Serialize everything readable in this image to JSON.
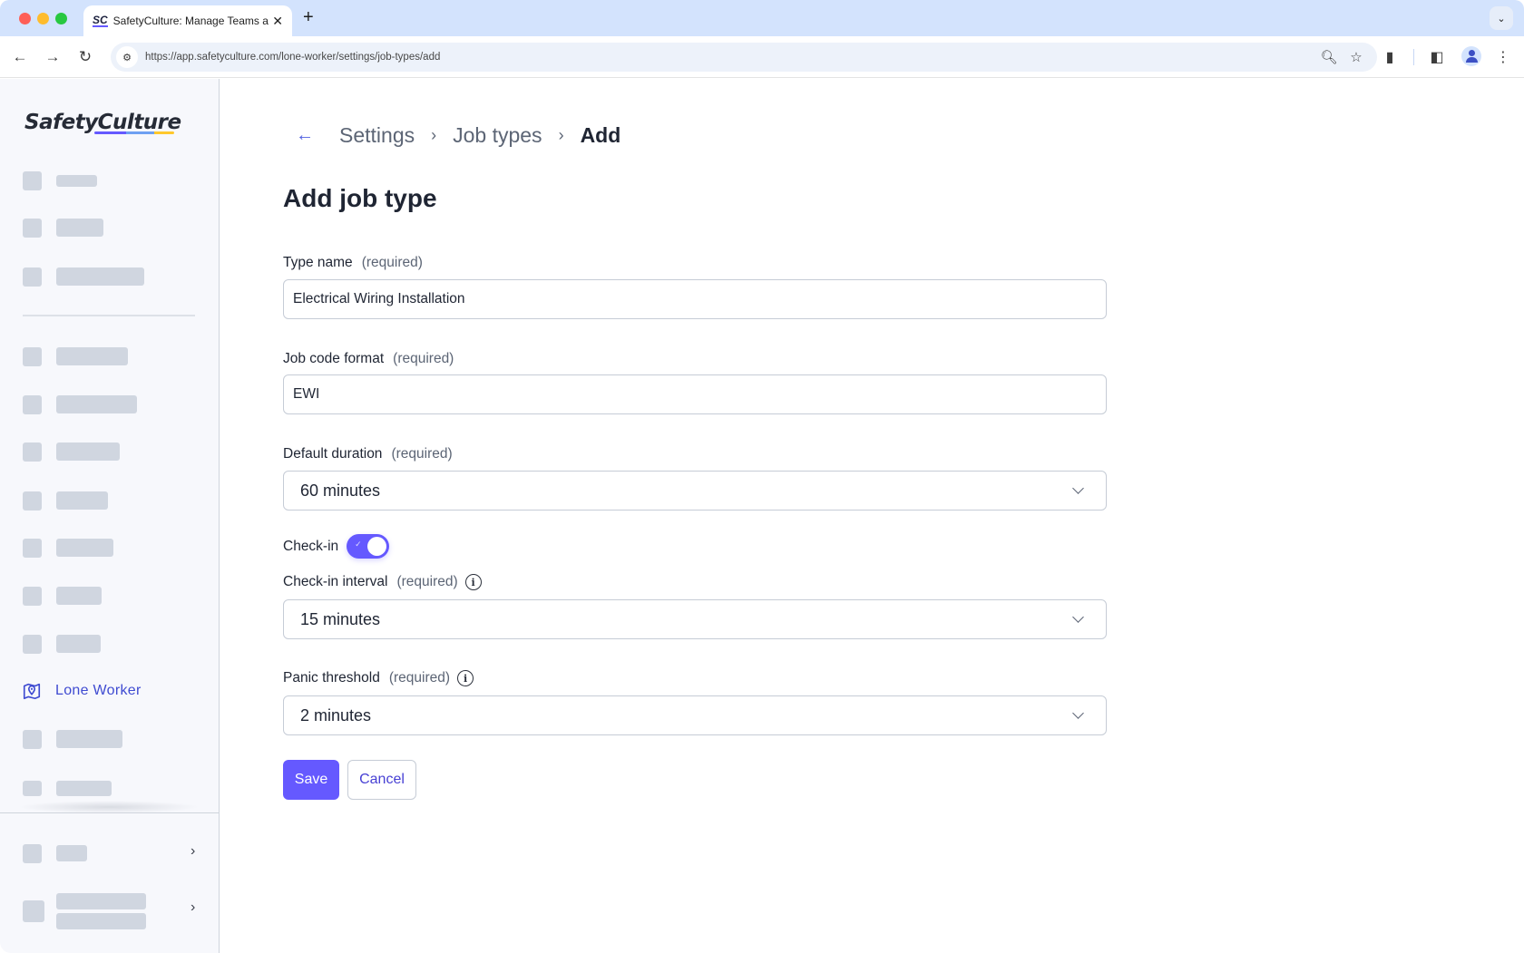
{
  "browser": {
    "tab_title": "SafetyCulture: Manage Teams and...",
    "tab_favicon": "SC",
    "tab_close": "✕",
    "new_tab": "+",
    "url": "https://app.safetyculture.com/lone-worker/settings/job-types/add"
  },
  "sidebar": {
    "logo": "SafetyCulture",
    "active_item": "Lone Worker",
    "expand_chevron": "›"
  },
  "breadcrumb": {
    "back": "←",
    "items": [
      "Settings",
      "Job types"
    ],
    "current": "Add",
    "separator": "›"
  },
  "page": {
    "title": "Add job type"
  },
  "form": {
    "type_name": {
      "label": "Type name",
      "required": "(required)",
      "value": "Electrical Wiring Installation"
    },
    "job_code_format": {
      "label": "Job code format",
      "required": "(required)",
      "value": "EWI"
    },
    "default_duration": {
      "label": "Default duration",
      "required": "(required)",
      "value": "60 minutes"
    },
    "check_in": {
      "label": "Check-in",
      "enabled": true,
      "check_glyph": "✓"
    },
    "check_in_interval": {
      "label": "Check-in interval",
      "required": "(required)",
      "value": "15 minutes",
      "info": "i"
    },
    "panic_threshold": {
      "label": "Panic threshold",
      "required": "(required)",
      "value": "2 minutes",
      "info": "i"
    }
  },
  "actions": {
    "save": "Save",
    "cancel": "Cancel"
  },
  "colors": {
    "accent": "#6559ff",
    "link": "#4740d4",
    "sidebar_active": "#3f4bd1"
  }
}
